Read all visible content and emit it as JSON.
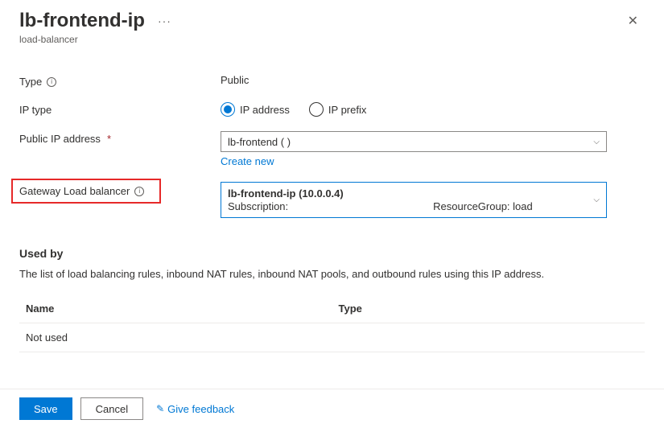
{
  "header": {
    "title": "lb-frontend-ip",
    "subtitle": "load-balancer",
    "more": "···"
  },
  "form": {
    "type_label": "Type",
    "type_value": "Public",
    "iptype_label": "IP type",
    "radio_address": "IP address",
    "radio_prefix": "IP prefix",
    "pubip_label": "Public IP address",
    "pubip_value": "lb-frontend (                          )",
    "create_new": "Create new",
    "gateway_label": "Gateway Load balancer",
    "gateway_line1": "lb-frontend-ip (10.0.0.4)",
    "gateway_sub_label": "Subscription:",
    "gateway_rg_label": "ResourceGroup: load"
  },
  "usedby": {
    "heading": "Used by",
    "desc": "The list of load balancing rules, inbound NAT rules, inbound NAT pools, and outbound rules using this IP address.",
    "col_name": "Name",
    "col_type": "Type",
    "row_name": "Not used",
    "row_type": ""
  },
  "footer": {
    "save": "Save",
    "cancel": "Cancel",
    "feedback": "Give feedback"
  }
}
